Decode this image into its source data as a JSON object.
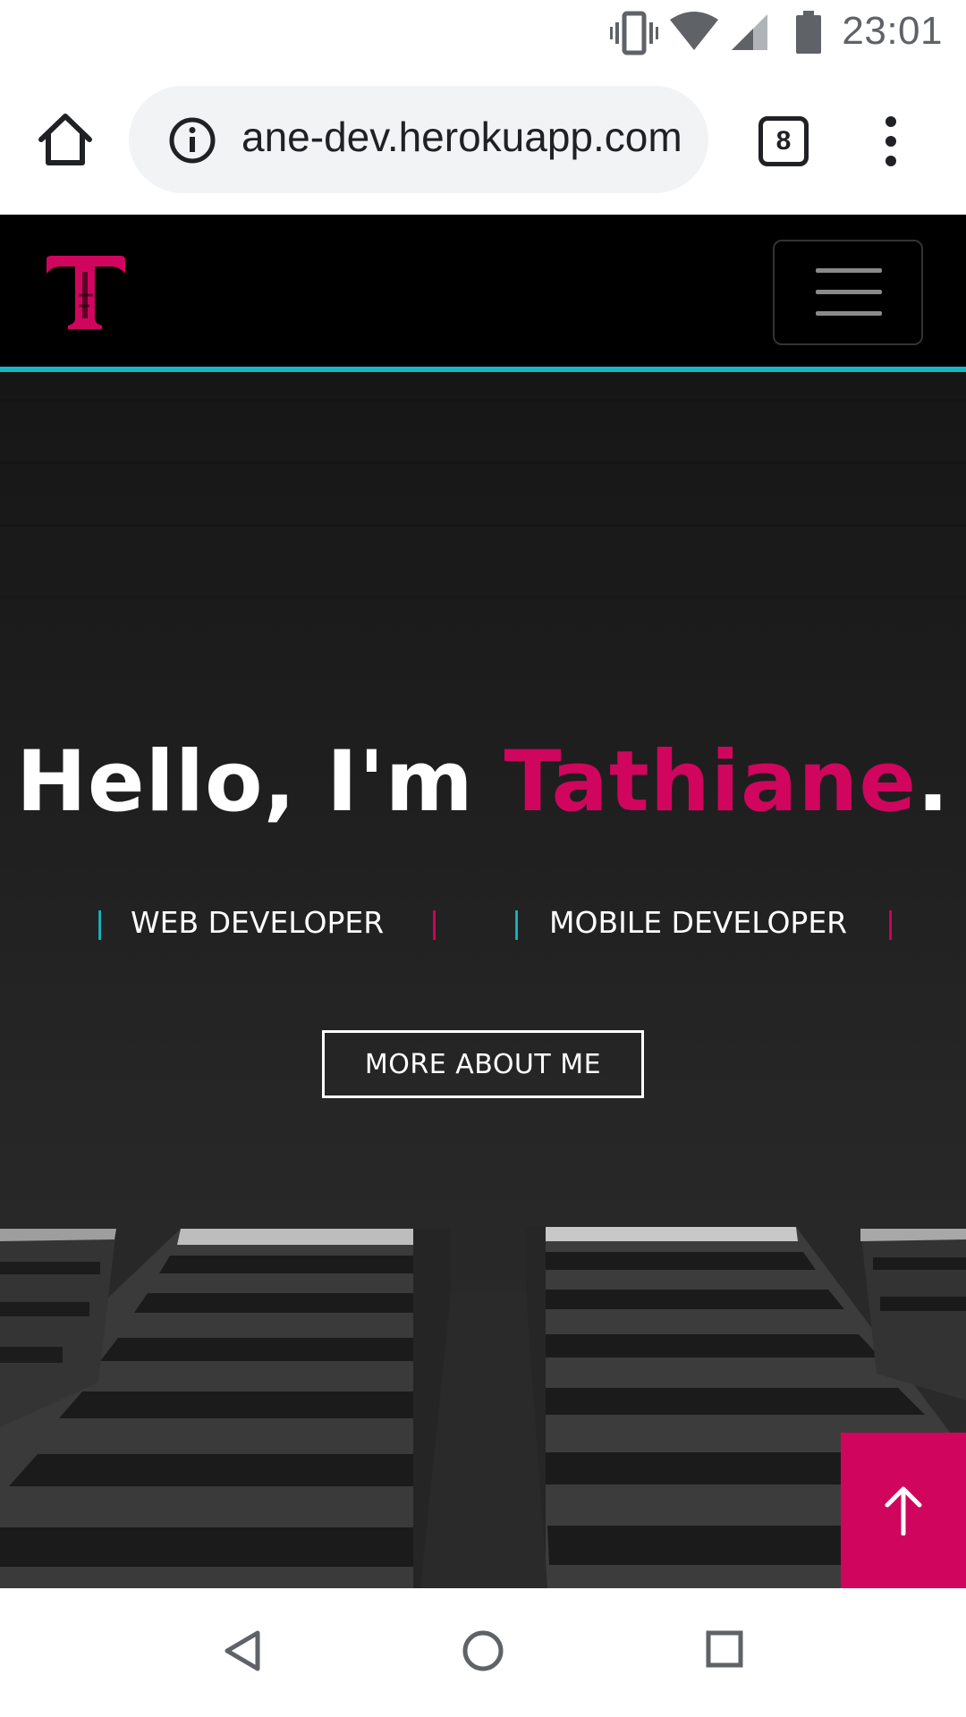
{
  "status_bar": {
    "time": "23:01",
    "icons": [
      "vibrate-icon",
      "wifi-icon",
      "cell-signal-icon",
      "battery-icon"
    ]
  },
  "browser": {
    "url": "tathiane-dev.herokuapp.com",
    "url_visible": "ane-dev.herokuapp.com",
    "tab_count": "8",
    "icons": [
      "home-icon",
      "info-icon",
      "tab-switcher-icon",
      "more-vert-icon"
    ]
  },
  "site": {
    "logo_letter": "T",
    "accent_color": "#d0055e",
    "secondary_color": "#17b8c4",
    "hero": {
      "greeting": "Hello, I'm ",
      "name": "Tathiane",
      "punctuation": ".",
      "roles": [
        "WEB DEVELOPER",
        "MOBILE DEVELOPER"
      ],
      "role_separator": "|",
      "cta_label": "MORE ABOUT ME"
    },
    "icons": [
      "menu-icon",
      "arrow-up-icon"
    ]
  },
  "android_nav": {
    "icons": [
      "back-icon",
      "home-circle-icon",
      "recents-icon"
    ]
  }
}
